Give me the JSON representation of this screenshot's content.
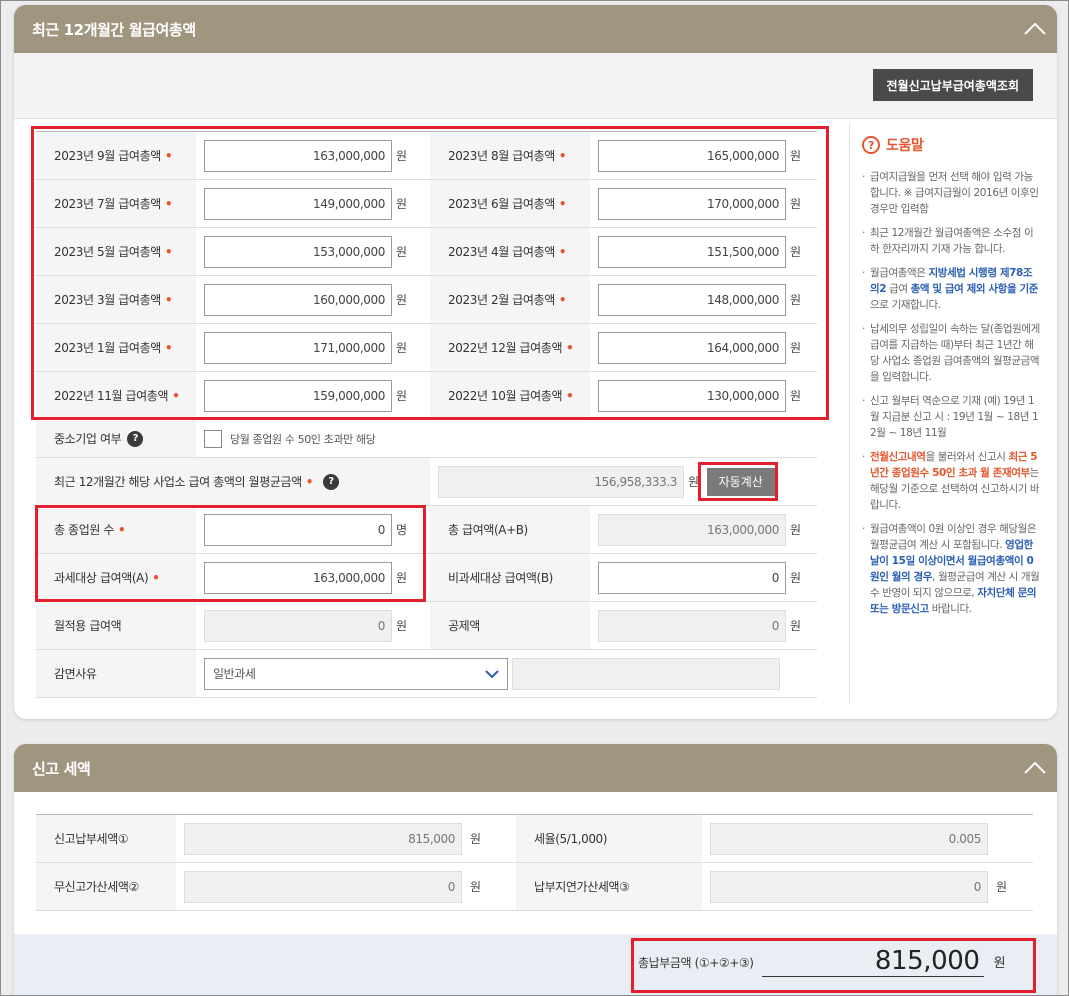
{
  "section1": {
    "title": "최근 12개월간 월급여총액",
    "lookup_button": "전월신고납부급여총액조회",
    "unit": "원",
    "months": [
      {
        "label": "2023년 9월 급여총액",
        "value": "163,000,000"
      },
      {
        "label": "2023년 8월 급여총액",
        "value": "165,000,000"
      },
      {
        "label": "2023년 7월 급여총액",
        "value": "149,000,000"
      },
      {
        "label": "2023년 6월 급여총액",
        "value": "170,000,000"
      },
      {
        "label": "2023년 5월 급여총액",
        "value": "153,000,000"
      },
      {
        "label": "2023년 4월 급여총액",
        "value": "151,500,000"
      },
      {
        "label": "2023년 3월 급여총액",
        "value": "160,000,000"
      },
      {
        "label": "2023년 2월 급여총액",
        "value": "148,000,000"
      },
      {
        "label": "2023년 1월 급여총액",
        "value": "171,000,000"
      },
      {
        "label": "2022년 12월 급여총액",
        "value": "164,000,000"
      },
      {
        "label": "2022년 11월 급여총액",
        "value": "159,000,000"
      },
      {
        "label": "2022년 10월 급여총액",
        "value": "130,000,000"
      }
    ],
    "sme_label": "중소기업 여부",
    "sme_checkbox_text": "당월 종업원 수 50인 초과만 해당",
    "avg_label": "최근 12개월간 해당 사업소 급여 총액의 월평균금액",
    "avg_value": "156,958,333.3",
    "auto_calc": "자동계산",
    "employees_label": "총 종업원 수",
    "employees_value": "0",
    "employees_unit": "명",
    "total_pay_label": "총 급여액(A+B)",
    "total_pay_value": "163,000,000",
    "taxable_label": "과세대상 급여액(A)",
    "taxable_value": "163,000,000",
    "nontaxable_label": "비과세대상 급여액(B)",
    "nontaxable_value": "0",
    "monthly_applied_label": "월적용 급여액",
    "monthly_applied_value": "0",
    "deduction_label": "공제액",
    "deduction_value": "0",
    "exemption_label": "감면사유",
    "exemption_value": "일반과세"
  },
  "help": {
    "title": "도움말",
    "items": [
      {
        "parts": [
          {
            "t": "급여지급월을 먼저 선택 해야 입력 가능 합니다."
          },
          {
            "t": " ※ 급여지급월이 2016년 이후인 경우만 입력함"
          }
        ]
      },
      {
        "parts": [
          {
            "t": "최근 12개월간 월급여총액은 소수점 이하 한자리까지 기재 가능 합니다."
          }
        ]
      },
      {
        "parts": [
          {
            "t": "월급여총액은 "
          },
          {
            "t": "지방세법 시행령 제78조의2",
            "c": "blue"
          },
          {
            "t": " 급여 "
          },
          {
            "t": "총액 및 급여 제외 사항을 기준",
            "c": "blue"
          },
          {
            "t": "으로 기재합니다."
          }
        ]
      },
      {
        "parts": [
          {
            "t": "납세의무 성립일이 속하는 달(종업원에게 급여를 지급하는 때)부터 최근 1년간 해당 사업소 종업원 급여총액의 월평균금액을 입력합니다."
          }
        ]
      },
      {
        "parts": [
          {
            "t": "신고 월부터 역순으로 기재"
          },
          {
            "t": " (예) 19년 1월 지급분 신고 시 : 19년 1월 ~ 18년 12월 ~ 18년 11월"
          }
        ]
      },
      {
        "parts": [
          {
            "t": "전월신고내역",
            "c": "orange"
          },
          {
            "t": "을 불러와서 신고시 "
          },
          {
            "t": "최근 5년간 종업원수 50인 초과 월 존재여부",
            "c": "orange"
          },
          {
            "t": "는 해당월 기준으로 선택하여 신고하시기 바랍니다."
          }
        ]
      },
      {
        "parts": [
          {
            "t": "월급여총액이 0원 이상인 경우 해당월은 월평균급여 계산 시 포함됩니다. "
          },
          {
            "t": "영업한 날이 15일 이상이면서 월급여총액이 0원인 월의 경우",
            "c": "blue"
          },
          {
            "t": ", 월평균급여 계산 시 개월 수 반영이 되지 않으므로, "
          },
          {
            "t": "자치단체 문의 또는 방문신고",
            "c": "blue"
          },
          {
            "t": " 바랍니다."
          }
        ]
      }
    ]
  },
  "section2": {
    "title": "신고 세액",
    "reported_tax_label": "신고납부세액①",
    "reported_tax_value": "815,000",
    "rate_label": "세율(5/1,000)",
    "rate_value": "0.005",
    "nonreport_label": "무신고가산세액②",
    "nonreport_value": "0",
    "late_label": "납부지연가산세액③",
    "late_value": "0",
    "total_label": "총납부금액 (①+②+③)",
    "total_value": "815,000",
    "unit": "원"
  }
}
